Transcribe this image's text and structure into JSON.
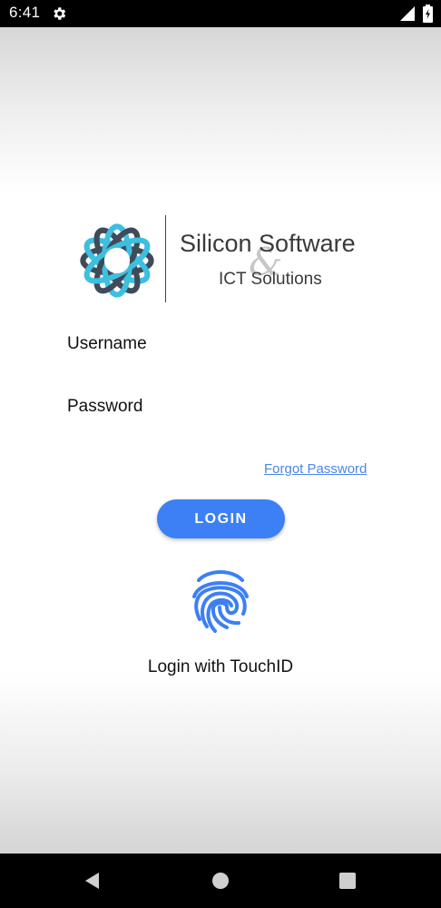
{
  "status_bar": {
    "time": "6:41",
    "icons": [
      "gear-icon",
      "signal-icon",
      "battery-icon"
    ]
  },
  "logo": {
    "title": "Silicon Software",
    "ampersand": "&",
    "subtitle": "ICT Solutions",
    "colors": {
      "primary": "#3dbfe0",
      "secondary": "#3f4b5a"
    }
  },
  "form": {
    "username_label": "Username",
    "username_value": "",
    "password_label": "Password",
    "password_value": "",
    "forgot_password": "Forgot Password",
    "login_button": "LOGIN"
  },
  "touchid": {
    "icon": "fingerprint-icon",
    "label": "Login with TouchID"
  },
  "nav_bar": {
    "icons": [
      "back-icon",
      "home-icon",
      "recents-icon"
    ]
  },
  "colors": {
    "accent": "#3d7ff5",
    "link": "#4a86e8"
  }
}
